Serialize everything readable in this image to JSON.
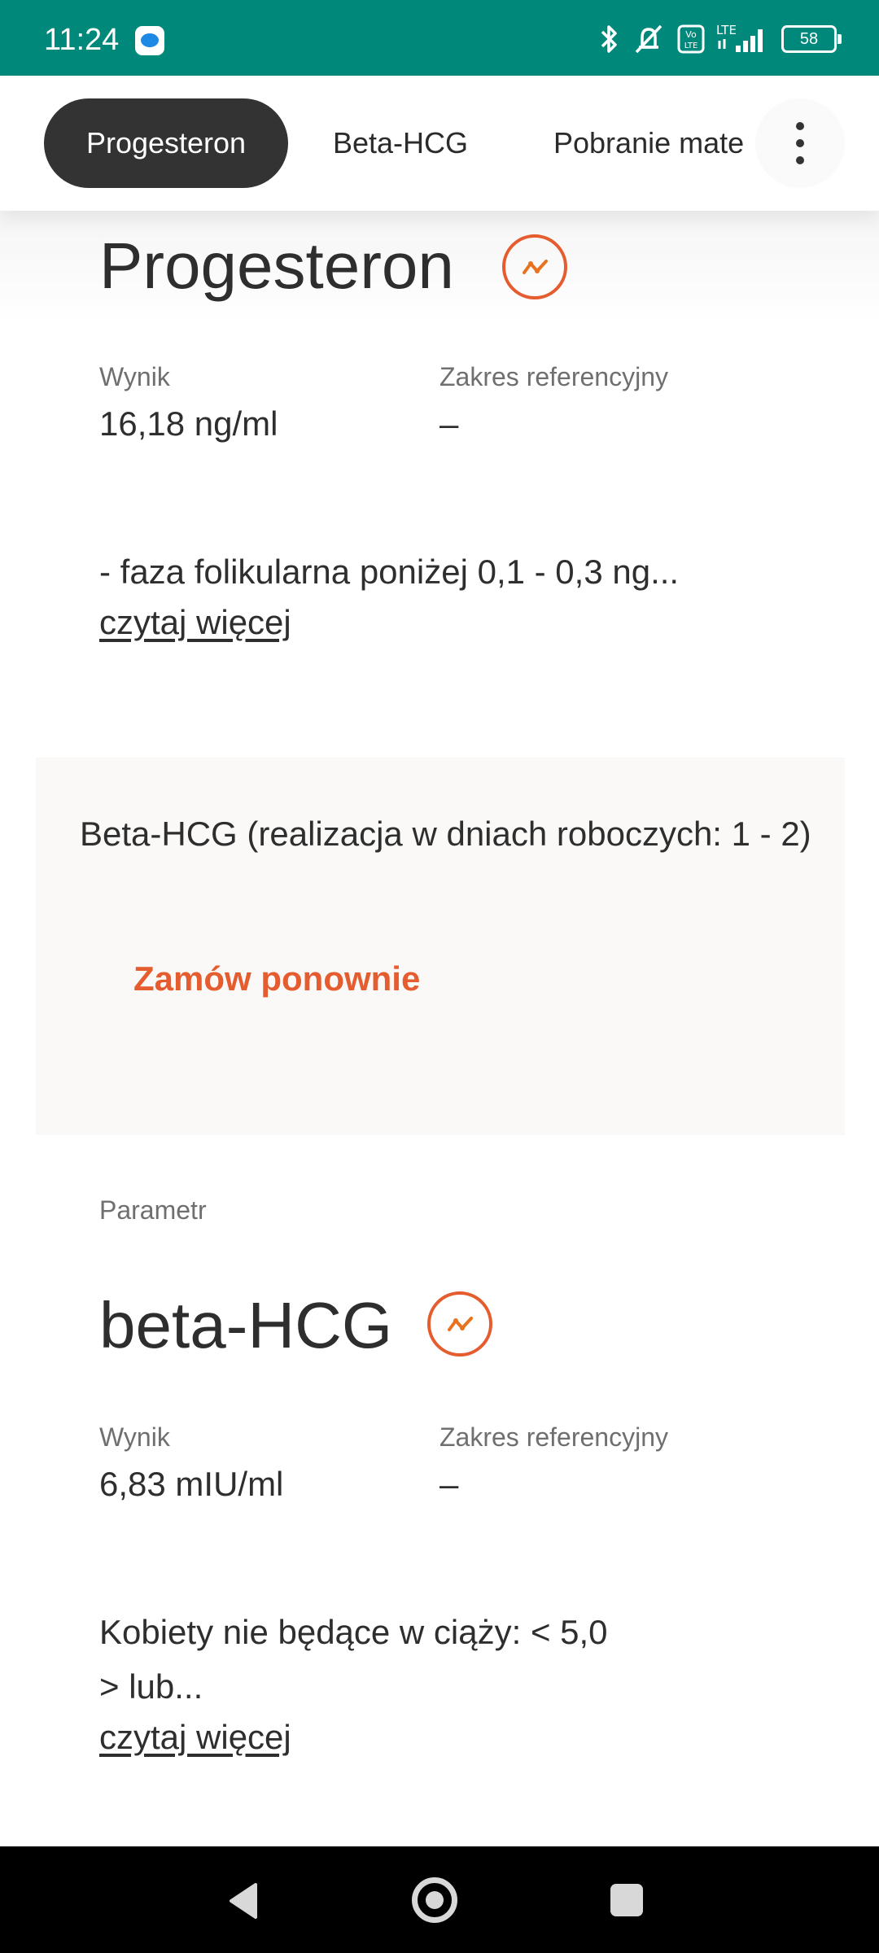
{
  "status_bar": {
    "time": "11:24",
    "battery": "58"
  },
  "tabs": [
    {
      "label": "Progesteron",
      "active": true
    },
    {
      "label": "Beta-HCG",
      "active": false
    },
    {
      "label": "Pobranie mate",
      "active": false
    }
  ],
  "progesteron": {
    "title": "Progesteron",
    "result_label": "Wynik",
    "result_value": "16,18 ng/ml",
    "range_label": "Zakres referencyjny",
    "range_value": "–",
    "description": "- faza folikularna poniżej 0,1 - 0,3 ng...",
    "read_more": "czytaj więcej"
  },
  "order_card": {
    "title": "Beta-HCG (realizacja w dniach roboczych: 1 - 2)",
    "reorder_label": "Zamów ponownie"
  },
  "beta_hcg": {
    "param_label": "Parametr",
    "title": "beta-HCG",
    "result_label": "Wynik",
    "result_value": "6,83 mIU/ml",
    "range_label": "Zakres referencyjny",
    "range_value": "–",
    "description_line1": "Kobiety nie będące w ciąży: < 5,0",
    "description_line2": "> lub...",
    "read_more": "czytaj więcej"
  },
  "colors": {
    "status_bar": "#00897b",
    "accent": "#e55c2f",
    "active_tab": "#333333",
    "card_bg": "#faf9f8"
  },
  "icons": [
    "bluetooth-icon",
    "mute-icon",
    "volte-icon",
    "signal-icon",
    "battery-icon",
    "trend-chart-icon",
    "more-vertical-icon",
    "back-icon",
    "home-icon",
    "recent-apps-icon"
  ]
}
